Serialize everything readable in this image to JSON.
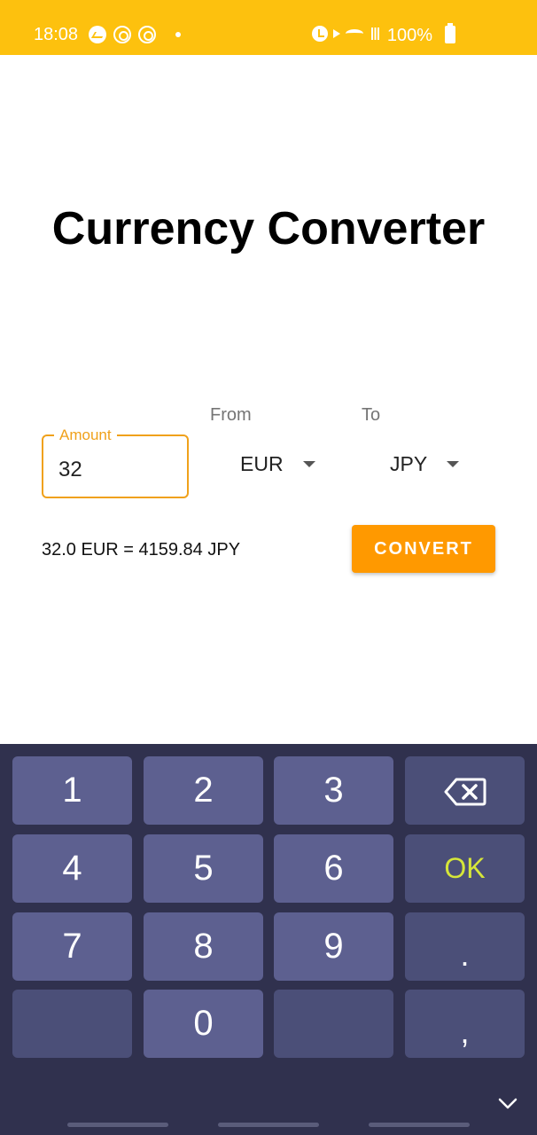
{
  "status_bar": {
    "time": "18:08",
    "battery": "100%",
    "left_icons": [
      "messenger-icon",
      "notification-ring-icon",
      "notification-ring-icon",
      "dot-icon"
    ],
    "right_icons": [
      "alarm-icon",
      "mute-icon",
      "wifi-icon",
      "signal-icon",
      "battery-icon"
    ],
    "color": "#FDC10E"
  },
  "app": {
    "title": "Currency Converter",
    "amount": {
      "label": "Amount",
      "value": "32"
    },
    "from": {
      "label": "From",
      "selected": "EUR"
    },
    "to": {
      "label": "To",
      "selected": "JPY"
    },
    "result": "32.0 EUR = 4159.84 JPY",
    "convert_label": "CONVERT",
    "accent_color": "#FF9900"
  },
  "keyboard": {
    "keys": [
      "1",
      "2",
      "3",
      "4",
      "5",
      "6",
      "7",
      "8",
      "9",
      "0"
    ],
    "ok_label": "OK",
    "dot_label": ".",
    "comma_label": ",",
    "background": "#30314E",
    "key_color": "#5D6090"
  }
}
